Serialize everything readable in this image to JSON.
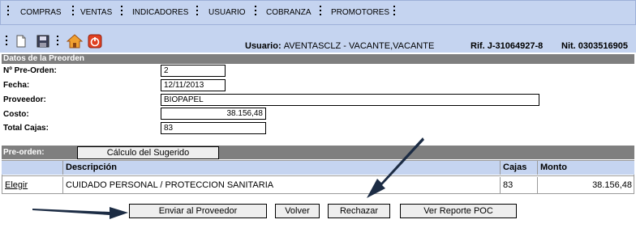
{
  "menu": {
    "items": [
      "COMPRAS",
      "VENTAS",
      "INDICADORES",
      "USUARIO",
      "COBRANZA",
      "PROMOTORES"
    ]
  },
  "toolbar": {
    "icons": [
      "new-document-icon",
      "save-icon",
      "home-icon",
      "power-icon"
    ],
    "user_label": "Usuario:",
    "user_value": "AVENTASCLZ - VACANTE,VACANTE",
    "rif_label": "Rif. J-31064927-8",
    "nit_label": "Nit. 0303516905"
  },
  "section_title": "Datos de la Preorden",
  "form": {
    "preorden_label": "Nº Pre-Orden:",
    "preorden_value": "2",
    "fecha_label": "Fecha:",
    "fecha_value": "12/11/2013",
    "proveedor_label": "Proveedor:",
    "proveedor_value": "BIOPAPEL",
    "costo_label": "Costo:",
    "costo_value": "38.156,48",
    "cajas_label": "Total Cajas:",
    "cajas_value": "83"
  },
  "preorden_bar": {
    "label": "Pre-orden:",
    "calc_button": "Cálculo del Sugerido"
  },
  "table": {
    "headers": [
      "",
      "Descripción",
      "Cajas",
      "Monto"
    ],
    "rows": [
      {
        "action": "Elegir",
        "descripcion": "CUIDADO PERSONAL / PROTECCION SANITARIA",
        "cajas": "83",
        "monto": "38.156,48"
      }
    ]
  },
  "actions": {
    "enviar": "Enviar al Proveedor",
    "volver": "Volver",
    "rechazar": "Rechazar",
    "reporte": "Ver Reporte POC"
  },
  "colors": {
    "menu_bg": "#c5d4f0",
    "section_bg": "#7f7f7f",
    "arrow": "#1c2c44"
  }
}
